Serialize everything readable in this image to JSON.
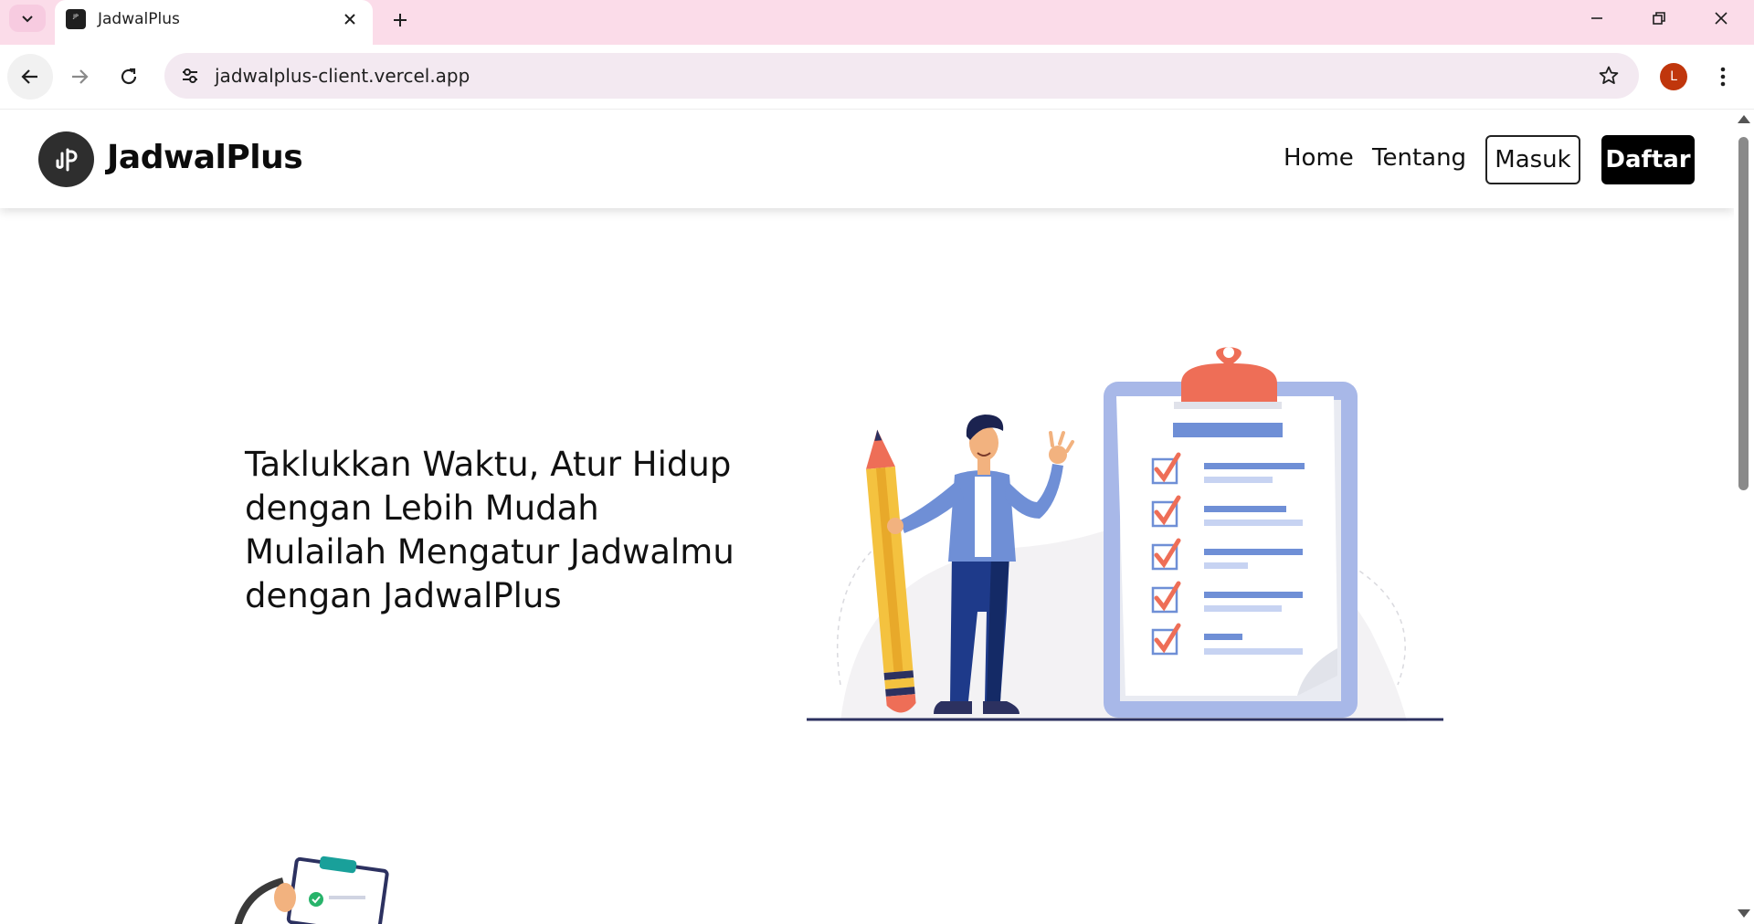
{
  "browser": {
    "tab_title": "JadwalPlus",
    "url": "jadwalplus-client.vercel.app",
    "profile_initial": "L",
    "tab_favicon_text": "ᴶᴾ"
  },
  "site": {
    "brand_name": "JadwalPlus",
    "nav": {
      "home": "Home",
      "about": "Tentang",
      "login": "Masuk",
      "register": "Daftar"
    },
    "hero": {
      "lines": [
        "Taklukkan Waktu, Atur Hidup",
        "dengan Lebih Mudah",
        "Mulailah Mengatur Jadwalmu",
        "dengan JadwalPlus"
      ]
    }
  },
  "colors": {
    "tabstrip": "#fbdce9",
    "omnibox": "#f3e9f1",
    "accent_red": "#ee6e57",
    "clipboard_blue": "#a8b8e8",
    "shirt_blue": "#6f8fd6",
    "pants_navy": "#1e3a8a",
    "pencil_yellow": "#f4c23f"
  }
}
